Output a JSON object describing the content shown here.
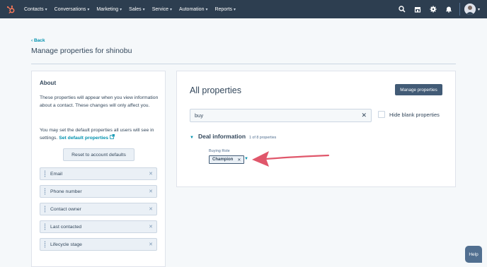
{
  "topnav": {
    "items": [
      "Contacts",
      "Conversations",
      "Marketing",
      "Sales",
      "Service",
      "Automation",
      "Reports"
    ],
    "icons": [
      "search-icon",
      "marketplace-icon",
      "settings-icon",
      "notifications-icon"
    ]
  },
  "header": {
    "back_label": "Back",
    "title": "Manage properties for shinobu"
  },
  "about": {
    "title": "About",
    "text1": "These properties will appear when you view information about a contact. These changes will only affect you.",
    "text2_prefix": "You may set the default properties all users will see in settings.",
    "link": "Set default properties",
    "reset_label": "Reset to account defaults",
    "properties": [
      "Email",
      "Phone number",
      "Contact owner",
      "Last contacted",
      "Lifecycle stage"
    ]
  },
  "all_properties": {
    "title": "All properties",
    "manage_label": "Manage properties",
    "search_value": "buy",
    "hide_blank_label": "Hide blank properties",
    "section_title": "Deal information",
    "section_count": "1 of 8 properties",
    "field_label": "Buying Role",
    "field_value": "Champion"
  },
  "help_label": "Help",
  "colors": {
    "nav_bg": "#2d3e50",
    "accent": "#0091ae",
    "logo": "#ff7a59",
    "arrow": "#e0576b"
  }
}
